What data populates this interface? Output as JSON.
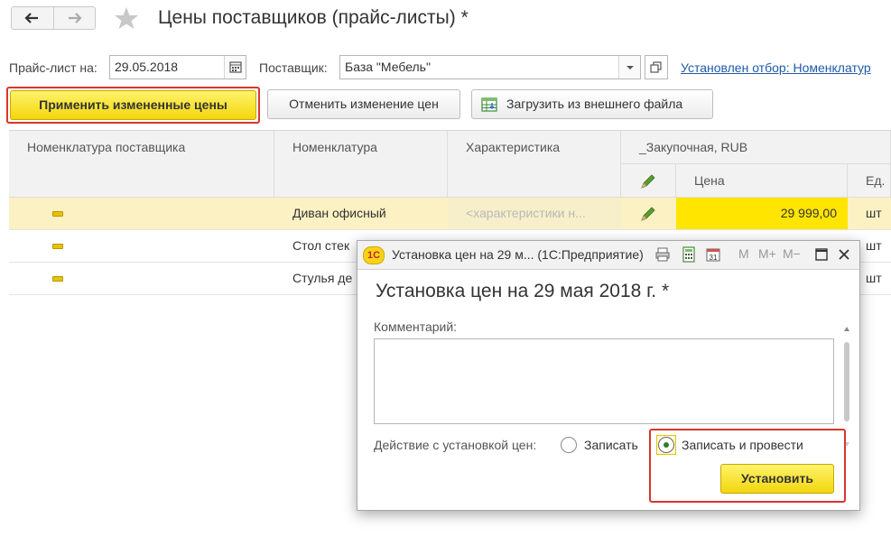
{
  "window": {
    "title": "Цены поставщиков (прайс-листы) *"
  },
  "filters": {
    "pricelist_label": "Прайс-лист на:",
    "pricelist_date": "29.05.2018",
    "supplier_label": "Поставщик:",
    "supplier_value": "База \"Мебель\"",
    "filter_link": "Установлен отбор: Номенклатур"
  },
  "toolbar": {
    "apply_label": "Применить измененные цены",
    "cancel_label": "Отменить изменение цен",
    "load_label": "Загрузить из внешнего файла"
  },
  "table": {
    "columns": {
      "supplier_item": "Номенклатура поставщика",
      "item": "Номенклатура",
      "characteristic": "Характеристика",
      "group": "_Закупочная, RUB",
      "price": "Цена",
      "unit": "Ед."
    },
    "rows": [
      {
        "item": "Диван офисный",
        "characteristic": "<характеристики н...",
        "price": "29 999,00",
        "unit": "шт"
      },
      {
        "item": "Стол стек",
        "characteristic": "",
        "price": "",
        "unit": "шт"
      },
      {
        "item": "Стулья де",
        "characteristic": "",
        "price": "",
        "unit": "шт"
      }
    ]
  },
  "dialog": {
    "title": "Установка цен на 29 м... (1С:Предприятие)",
    "heading": "Установка цен на 29 мая 2018 г. *",
    "comment_label": "Комментарий:",
    "comment_value": "",
    "action_label": "Действие с установкой цен:",
    "option_write": "Записать",
    "option_write_post": "Записать и провести",
    "selected_option": "option_write_post",
    "install_label": "Установить",
    "memory_buttons": {
      "m": "M",
      "m_plus": "M+",
      "m_minus": "M−"
    },
    "calendar_number": "31",
    "logo_text": "1С"
  },
  "colors": {
    "accent_yellow": "#f2d60e",
    "highlight": "#d9372b",
    "link": "#1f5aa8"
  }
}
